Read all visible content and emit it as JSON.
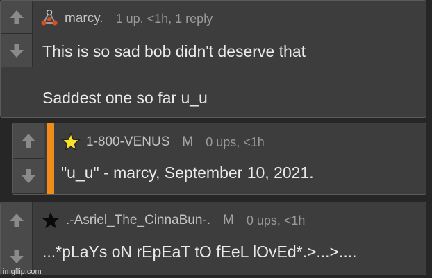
{
  "comments": [
    {
      "username": "marcy.",
      "mod": "",
      "meta": "1 up, <1h, 1 reply",
      "avatar_icon": "tri-dot-avatar-icon",
      "lines": [
        "This is so sad bob didn't deserve that",
        "Saddest one so far u_u"
      ]
    },
    {
      "username": "1-800-VENUS",
      "mod": "M",
      "meta": "0 ups, <1h",
      "avatar_icon": "yellow-star-icon",
      "lines": [
        "\"u_u\" - marcy, September 10, 2021."
      ]
    },
    {
      "username": ".-Asriel_The_CinnaBun-.",
      "mod": "M",
      "meta": "0 ups, <1h",
      "avatar_icon": "black-star-icon",
      "lines": [
        "...*pLaYs oN rEpEaT tO fEeL lOvEd*.>...>...."
      ]
    }
  ],
  "colors": {
    "background": "#262626",
    "card": "#3d3d3d",
    "accent": "#f08c1a",
    "star_yellow": "#f5e12a"
  },
  "watermark": "imgflip.com"
}
